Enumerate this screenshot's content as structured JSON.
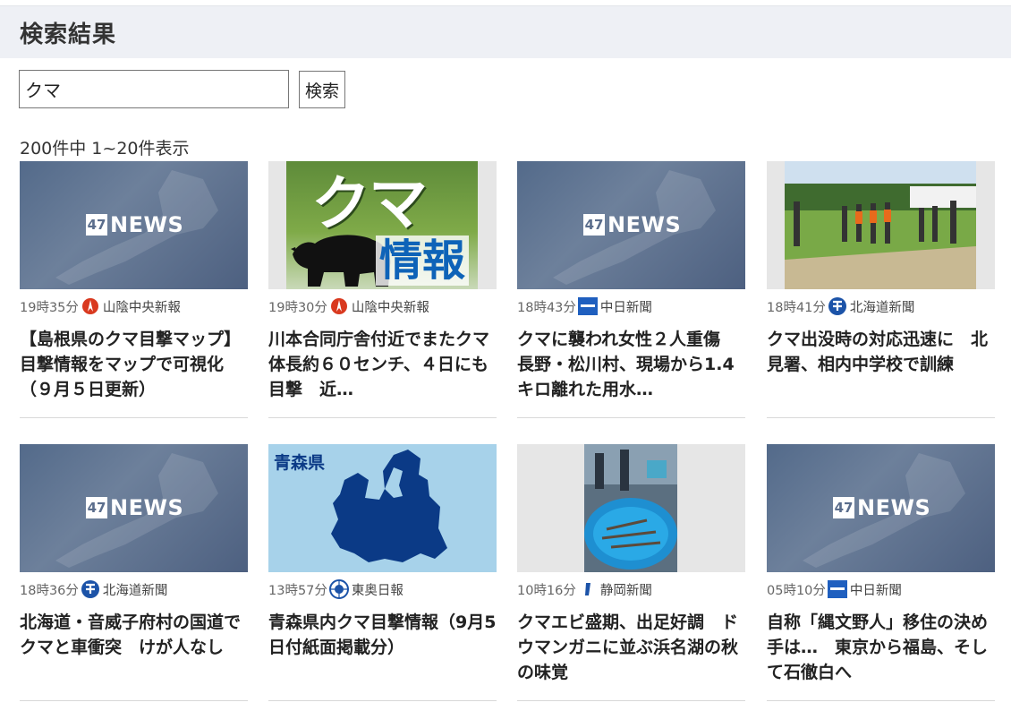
{
  "header": {
    "title": "検索結果"
  },
  "search": {
    "value": "クマ",
    "button_label": "検索"
  },
  "result_count": "200件中 1~20件表示",
  "thumb_text": {
    "news47_box": "47",
    "news47_word": "NEWS",
    "kuma_big": "クマ",
    "kuma_info": "情報",
    "aomori_label": "青森県"
  },
  "articles": [
    {
      "time": "19時35分",
      "publisher": "山陰中央新報",
      "title": "【島根県のクマ目撃マップ】目撃情報をマップで可視化（９月５日更新）",
      "thumb": "47news-thumb",
      "logo": "sanin-logo-icon"
    },
    {
      "time": "19時30分",
      "publisher": "山陰中央新報",
      "title": "川本合同庁舎付近でまたクマ　体長約６０センチ、４日にも目撃　近…",
      "thumb": "bear-info-thumb",
      "logo": "sanin-logo-icon"
    },
    {
      "time": "18時43分",
      "publisher": "中日新聞",
      "title": "クマに襲われ女性２人重傷　長野・松川村、現場から1.4キロ離れた用水…",
      "thumb": "47news-thumb",
      "logo": "chunichi-logo-icon"
    },
    {
      "time": "18時41分",
      "publisher": "北海道新聞",
      "title": "クマ出没時の対応迅速に　北見署、相内中学校で訓練",
      "thumb": "field-photo-thumb",
      "logo": "hokkaido-logo-icon"
    },
    {
      "time": "18時36分",
      "publisher": "北海道新聞",
      "title": "北海道・音威子府村の国道でクマと車衝突　けが人なし",
      "thumb": "47news-thumb",
      "logo": "hokkaido-logo-icon"
    },
    {
      "time": "13時57分",
      "publisher": "東奥日報",
      "title": "青森県内クマ目撃情報（9月5日付紙面掲載分）",
      "thumb": "aomori-map-thumb",
      "logo": "toonippo-logo-icon"
    },
    {
      "time": "10時16分",
      "publisher": "静岡新聞",
      "title": "クマエビ盛期、出足好調　ドウマンガニに並ぶ浜名湖の秋の味覚",
      "thumb": "shrimp-photo-thumb",
      "logo": "shizuoka-logo-icon"
    },
    {
      "time": "05時10分",
      "publisher": "中日新聞",
      "title": "自称「縄文野人」移住の決め手は…　東京から福島、そして石徹白へ",
      "thumb": "47news-thumb",
      "logo": "chunichi-logo-icon"
    }
  ],
  "colors": {
    "header_bg": "#eef0f5",
    "sanin": "#d9391f",
    "chunichi": "#1f5fbf",
    "hokkaido": "#1c53a8",
    "aomori_sea": "#a7d2ea",
    "aomori_land": "#0b3a86"
  }
}
